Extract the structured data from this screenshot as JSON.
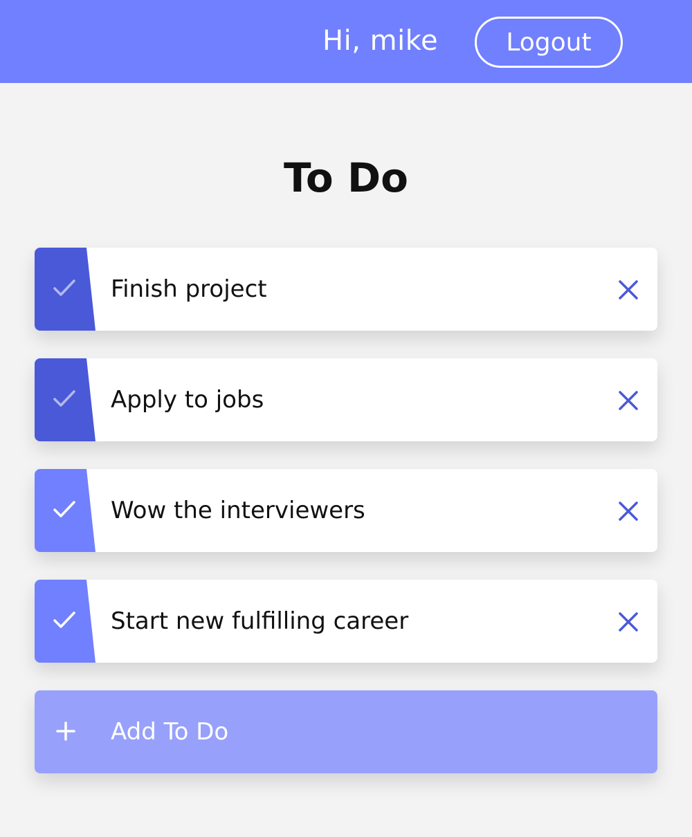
{
  "header": {
    "greeting": "Hi, mike",
    "logout_label": "Logout"
  },
  "page": {
    "title": "To Do"
  },
  "todos": [
    {
      "text": "Finish project",
      "completed": true
    },
    {
      "text": "Apply to jobs",
      "completed": true
    },
    {
      "text": "Wow the interviewers",
      "completed": false
    },
    {
      "text": "Start new fulfilling career",
      "completed": false
    }
  ],
  "add": {
    "label": "Add To Do"
  },
  "icons": {
    "check": "check-icon",
    "delete": "close-icon",
    "add": "plus-icon"
  },
  "colors": {
    "header_bg": "#7180fe",
    "page_bg": "#f3f3f3",
    "check_done_bg": "#4a59d8",
    "check_pending_bg": "#7180fe",
    "check_done_mark": "#b3b8ef",
    "check_pending_mark": "#ffffff",
    "delete_icon": "#4a59d8",
    "add_bg": "#97a1fb"
  }
}
